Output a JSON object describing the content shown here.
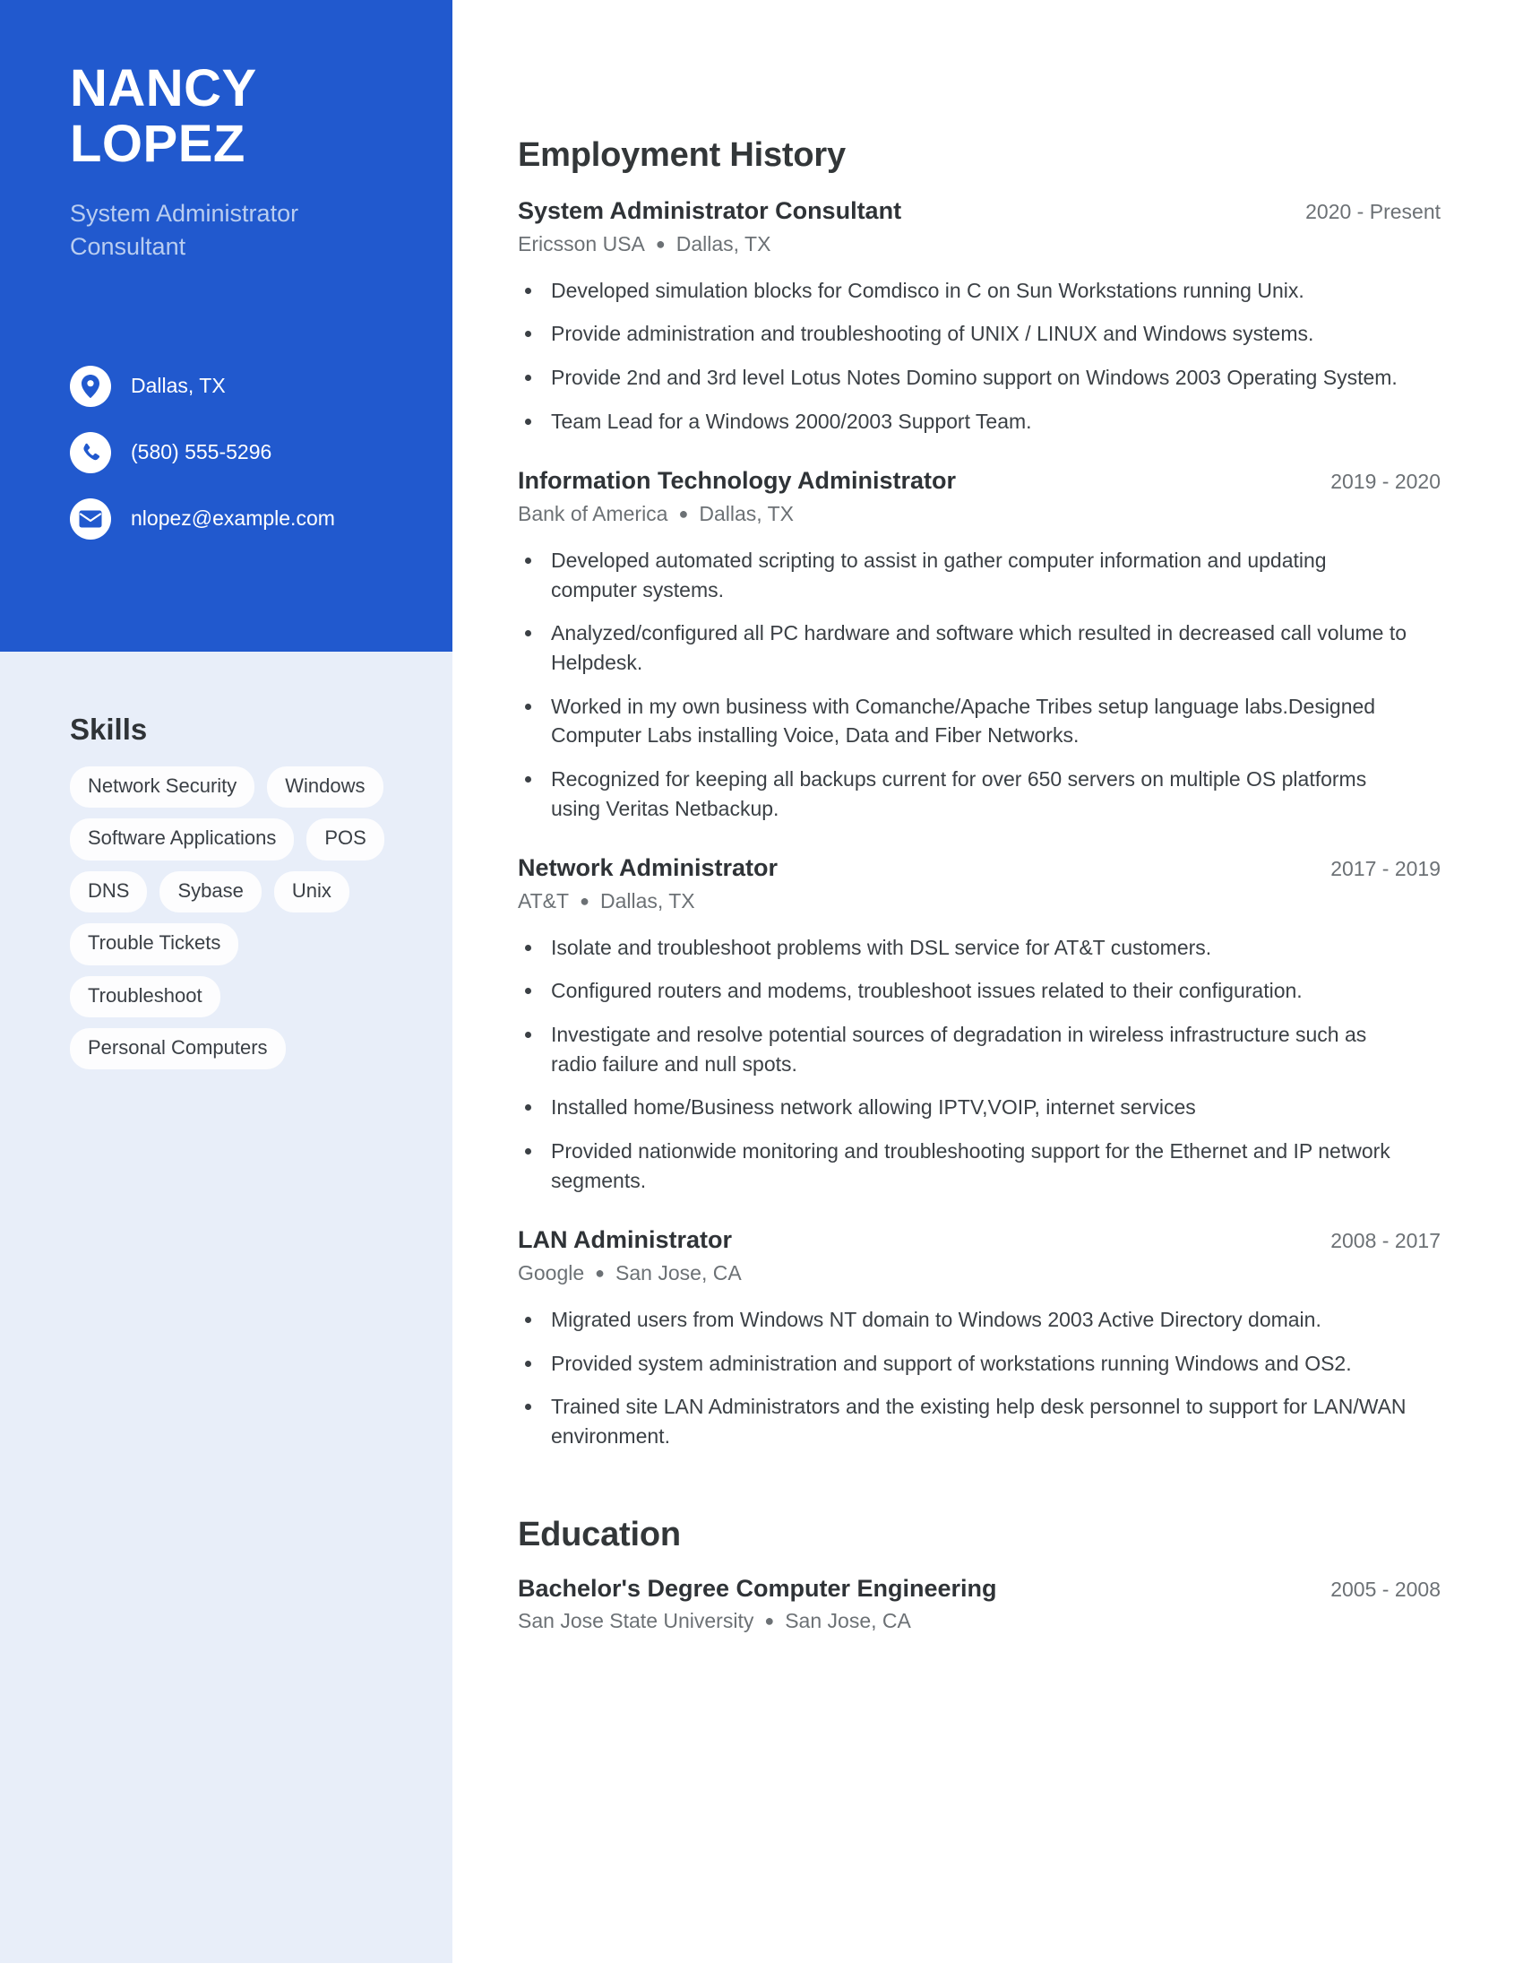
{
  "colors": {
    "accent_blue": "#2159ce",
    "sidebar_bg": "#e8eef9",
    "pill_bg": "#fdfdfe",
    "heading_text": "#2f3337",
    "muted_text": "#6c7175"
  },
  "sidebar": {
    "first_name": "NANCY",
    "last_name": "LOPEZ",
    "headline": "System Administrator Consultant",
    "contacts": [
      {
        "icon": "location-pin-icon",
        "value": "Dallas, TX"
      },
      {
        "icon": "phone-icon",
        "value": "(580) 555-5296"
      },
      {
        "icon": "envelope-icon",
        "value": "nlopez@example.com"
      }
    ],
    "skills_title": "Skills",
    "skills": [
      "Network Security",
      "Windows",
      "Software Applications",
      "POS",
      "DNS",
      "Sybase",
      "Unix",
      "Trouble Tickets",
      "Troubleshoot",
      "Personal Computers"
    ]
  },
  "main": {
    "employment_title": "Employment History",
    "education_title": "Education",
    "jobs": [
      {
        "role": "System Administrator Consultant",
        "dates": "2020 - Present",
        "company": "Ericsson USA",
        "location": "Dallas, TX",
        "bullets": [
          "Developed simulation blocks for Comdisco in C on Sun Workstations running Unix.",
          "Provide administration and troubleshooting of UNIX / LINUX and Windows systems.",
          "Provide 2nd and 3rd level Lotus Notes Domino support on Windows 2003 Operating System.",
          "Team Lead for a Windows 2000/2003 Support Team."
        ]
      },
      {
        "role": "Information Technology Administrator",
        "dates": "2019 - 2020",
        "company": "Bank of America",
        "location": "Dallas, TX",
        "bullets": [
          "Developed automated scripting to assist in gather computer information and updating computer systems.",
          "Analyzed/configured all PC hardware and software which resulted in decreased call volume to Helpdesk.",
          "Worked in my own business with Comanche/Apache Tribes setup language labs.Designed Computer Labs installing Voice, Data and Fiber Networks.",
          "Recognized for keeping all backups current for over 650 servers on multiple OS platforms using Veritas Netbackup."
        ]
      },
      {
        "role": "Network Administrator",
        "dates": "2017 - 2019",
        "company": "AT&T",
        "location": "Dallas, TX",
        "bullets": [
          "Isolate and troubleshoot problems with DSL service for AT&T customers.",
          "Configured routers and modems, troubleshoot issues related to their configuration.",
          "Investigate and resolve potential sources of degradation in wireless infrastructure such as radio failure and null spots.",
          "Installed home/Business network allowing IPTV,VOIP, internet services",
          "Provided nationwide monitoring and troubleshooting support for the Ethernet and IP network segments."
        ]
      },
      {
        "role": "LAN Administrator",
        "dates": "2008 - 2017",
        "company": "Google",
        "location": "San Jose, CA",
        "bullets": [
          "Migrated users from Windows NT domain to Windows 2003 Active Directory domain.",
          "Provided system administration and support of workstations running Windows and OS2.",
          "Trained site LAN Administrators and the existing help desk personnel to support for LAN/WAN environment."
        ]
      }
    ],
    "education": [
      {
        "degree": "Bachelor's Degree Computer Engineering",
        "dates": "2005 - 2008",
        "school": "San Jose State University",
        "location": "San Jose, CA"
      }
    ]
  }
}
